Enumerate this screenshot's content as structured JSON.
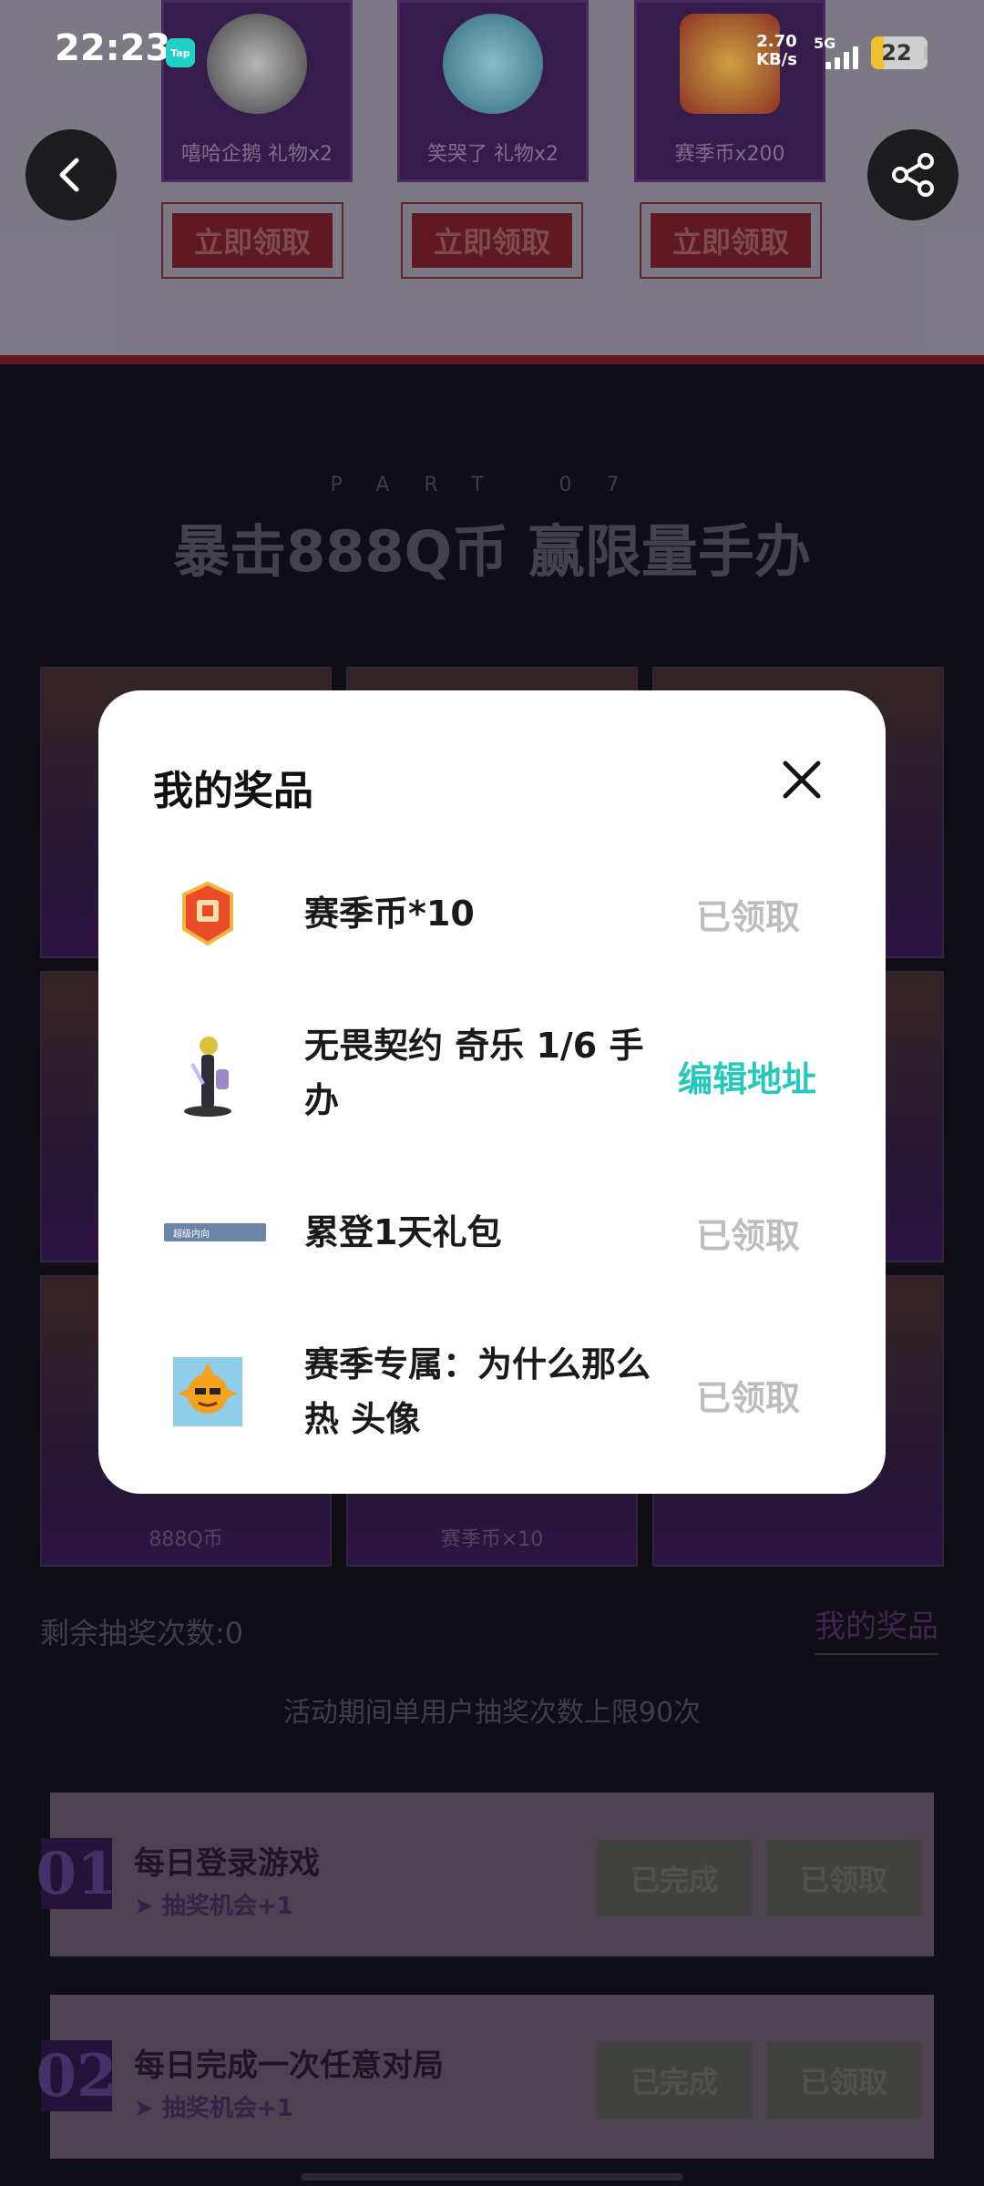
{
  "status_bar": {
    "time": "22:23",
    "app_badge": "Tap",
    "net_speed_value": "2.70",
    "net_speed_unit": "KB/s",
    "network": "5G",
    "battery": "22"
  },
  "top_rewards": [
    {
      "label": "嘻哈企鹅 礼物x2",
      "claim": "立即领取"
    },
    {
      "label": "笑哭了 礼物x2",
      "claim": "立即领取"
    },
    {
      "label": "赛季币x200",
      "claim": "立即领取"
    }
  ],
  "section": {
    "part": "PART 07",
    "title": "暴击888Q币 赢限量手办"
  },
  "grid_labels": {
    "bottom_left": "888Q币",
    "bottom_middle": "赛季币×10"
  },
  "lottery": {
    "remaining": "剩余抽奖次数:0",
    "my_prizes_link": "我的奖品",
    "limit_note": "活动期间单用户抽奖次数上限90次"
  },
  "tasks": [
    {
      "num": "01",
      "title": "每日登录游戏",
      "sub": "➤ 抽奖机会+1",
      "btn1": "已完成",
      "btn2": "已领取"
    },
    {
      "num": "02",
      "title": "每日完成一次任意对局",
      "sub": "➤ 抽奖机会+1",
      "btn1": "已完成",
      "btn2": "已领取"
    }
  ],
  "modal": {
    "title": "我的奖品",
    "items": [
      {
        "name": "赛季币*10",
        "status": "已领取",
        "icon": "season-coin-icon"
      },
      {
        "name": "无畏契约 奇乐 1/6 手办",
        "status": "编辑地址",
        "icon": "figure-icon"
      },
      {
        "name": "累登1天礼包",
        "status": "已领取",
        "icon": "card-banner-icon",
        "badge": "超级内向"
      },
      {
        "name": "赛季专属：为什么那么热 头像",
        "status": "已领取",
        "icon": "sun-avatar-icon"
      }
    ]
  },
  "colors": {
    "accent": "#26c7bd",
    "claimed": "#bdbdc1",
    "modal_bg": "#ffffff"
  }
}
